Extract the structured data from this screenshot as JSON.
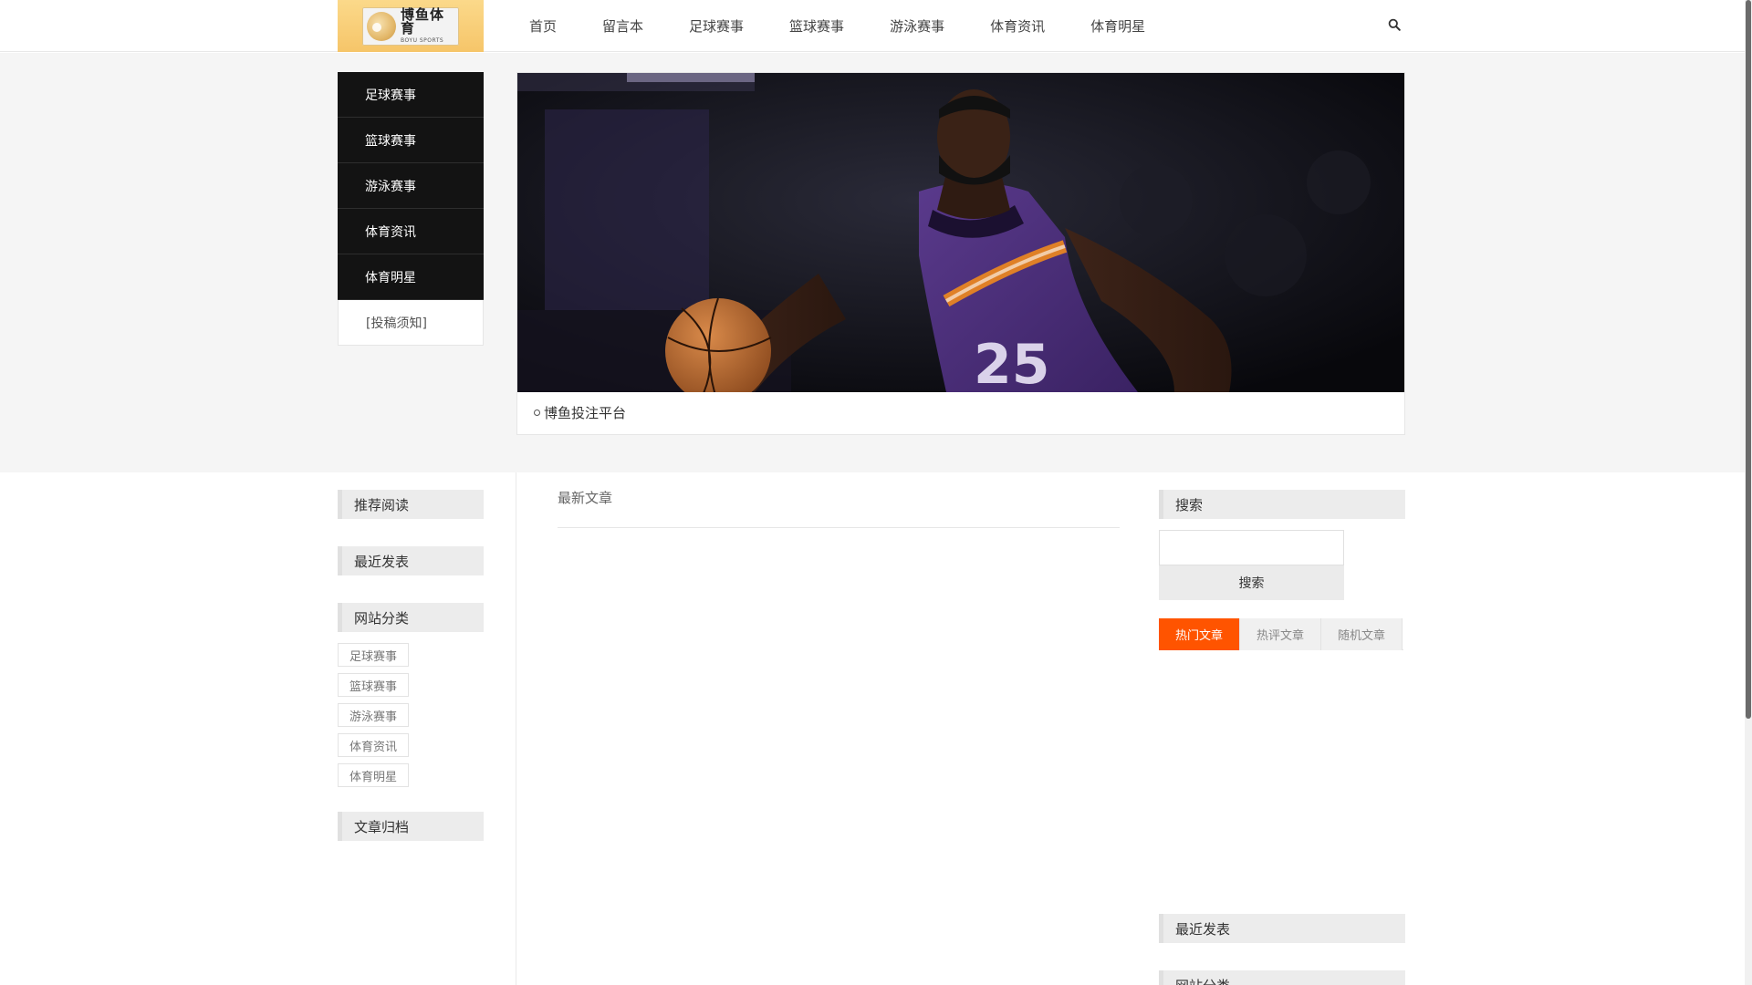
{
  "logo": {
    "cn": "博鱼体育",
    "en": "BOYU SPORTS"
  },
  "nav": [
    "首页",
    "留言本",
    "足球赛事",
    "篮球赛事",
    "游泳赛事",
    "体育资讯",
    "体育明星"
  ],
  "side_menu": [
    "足球赛事",
    "篮球赛事",
    "游泳赛事",
    "体育资讯",
    "体育明星",
    "[投稿须知]"
  ],
  "banner": {
    "caption": "博鱼投注平台"
  },
  "left_widgets": {
    "recommended": "推荐阅读",
    "recent": "最近发表",
    "categories": "网站分类",
    "category_tags": [
      "足球赛事",
      "篮球赛事",
      "游泳赛事",
      "体育资讯",
      "体育明星"
    ],
    "archive": "文章归档"
  },
  "main": {
    "title": "最新文章"
  },
  "right_widgets": {
    "search_title": "搜索",
    "search_button": "搜索",
    "tabs": [
      "热门文章",
      "热评文章",
      "随机文章"
    ],
    "recent": "最近发表",
    "categories": "网站分类"
  },
  "colors": {
    "accent": "#ff5400",
    "menu_bg": "#131313",
    "logo_bg": "#f6c569"
  }
}
